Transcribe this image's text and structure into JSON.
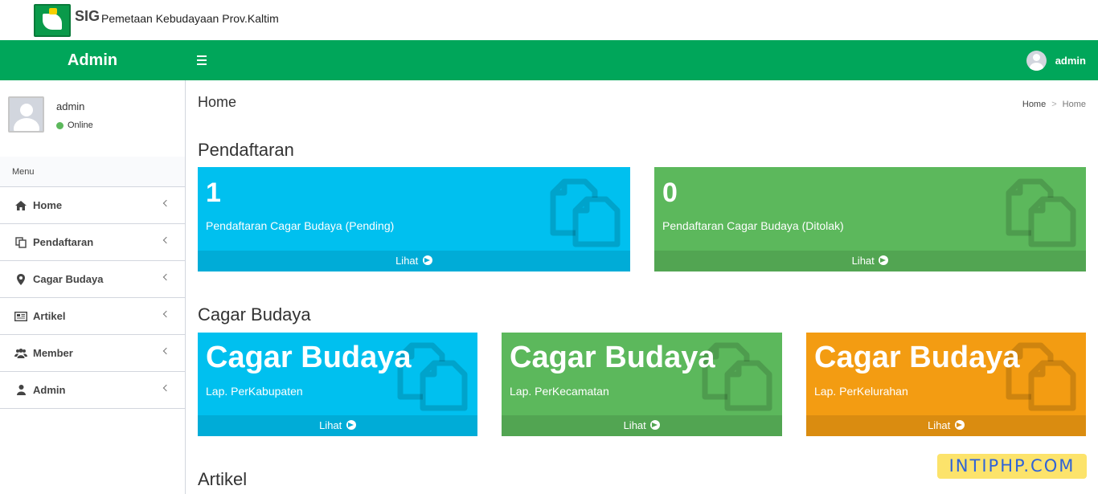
{
  "brand": {
    "sig": "SIG",
    "title": "Pemetaan Kebudayaan Prov.Kaltim",
    "logo_icon": "kaltim-emblem-icon"
  },
  "header": {
    "title": "Admin",
    "username": "admin",
    "bg_color": "#00a65a"
  },
  "sidebar": {
    "user": {
      "name": "admin",
      "status": "Online"
    },
    "menu_header": "Menu",
    "items": [
      {
        "label": "Home",
        "icon": "home-icon"
      },
      {
        "label": "Pendaftaran",
        "icon": "copy-icon"
      },
      {
        "label": "Cagar Budaya",
        "icon": "map-marker-icon"
      },
      {
        "label": "Artikel",
        "icon": "newspaper-icon"
      },
      {
        "label": "Member",
        "icon": "users-icon"
      },
      {
        "label": "Admin",
        "icon": "user-icon"
      }
    ]
  },
  "main": {
    "page_title": "Home",
    "breadcrumb": {
      "home": "Home",
      "sep": ">",
      "current": "Home"
    },
    "sections": {
      "pendaftaran": "Pendaftaran",
      "cagar_budaya": "Cagar Budaya",
      "artikel": "Artikel"
    },
    "pendaftaran_boxes": [
      {
        "value": "1",
        "label": "Pendaftaran Cagar Budaya (Pending)",
        "link": "Lihat",
        "color": "#00c0ef"
      },
      {
        "value": "0",
        "label": "Pendaftaran Cagar Budaya (Ditolak)",
        "link": "Lihat",
        "color": "#5cb85c"
      }
    ],
    "cagar_boxes": [
      {
        "title": "Cagar Budaya",
        "label": "Lap. PerKabupaten",
        "link": "Lihat",
        "color": "#00c0ef"
      },
      {
        "title": "Cagar Budaya",
        "label": "Lap. PerKecamatan",
        "link": "Lihat",
        "color": "#5cb85c"
      },
      {
        "title": "Cagar Budaya",
        "label": "Lap. PerKelurahan",
        "link": "Lihat",
        "color": "#f39c12"
      }
    ]
  },
  "watermark": "INTIPHP.COM"
}
